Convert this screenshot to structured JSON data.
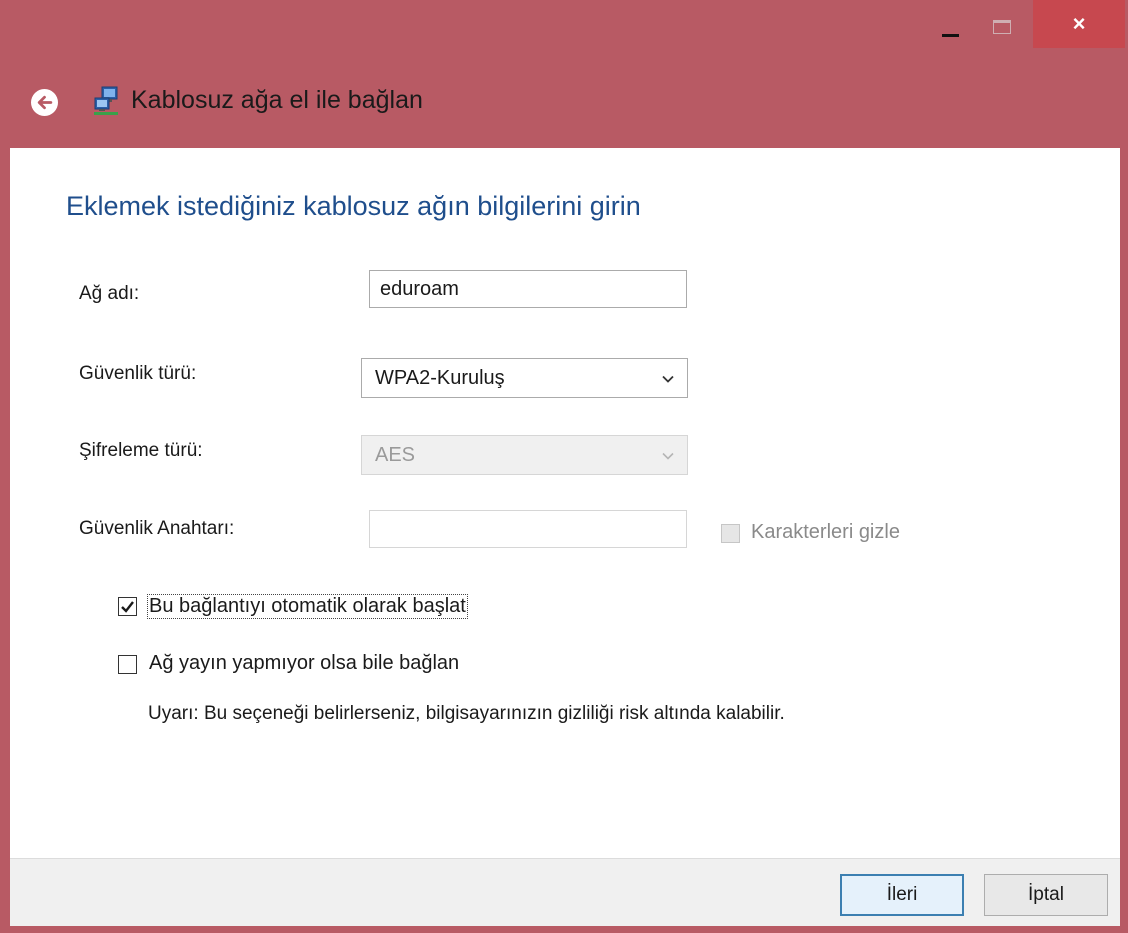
{
  "window": {
    "close_glyph": "×"
  },
  "nav": {
    "title": "Kablosuz ağa el ile bağlan"
  },
  "heading": "Eklemek istediğiniz kablosuz ağın bilgilerini girin",
  "form": {
    "network_name_label": "Ağ adı:",
    "network_name_value": "eduroam",
    "security_type_label": "Güvenlik türü:",
    "security_type_value": "WPA2-Kuruluş",
    "encryption_type_label": "Şifreleme türü:",
    "encryption_type_value": "AES",
    "security_key_label": "Güvenlik Anahtarı:",
    "security_key_value": "",
    "hide_chars_label": "Karakterleri gizle"
  },
  "options": {
    "auto_start_label": "Bu bağlantıyı otomatik olarak başlat",
    "auto_start_checked": true,
    "connect_hidden_label": "Ağ yayın yapmıyor olsa bile bağlan",
    "connect_hidden_checked": false,
    "warning": "Uyarı: Bu seçeneği belirlerseniz, bilgisayarınızın gizliliği risk altında kalabilir."
  },
  "footer": {
    "next_label": "İleri",
    "cancel_label": "İptal"
  },
  "colors": {
    "titlebar": "#b85a64",
    "heading": "#1f4e8c",
    "close_button": "#c7484f"
  },
  "icons": {
    "back": "back-arrow-icon",
    "network": "network-connection-icon",
    "chevron": "chevron-down-icon",
    "check": "checkmark-icon"
  }
}
